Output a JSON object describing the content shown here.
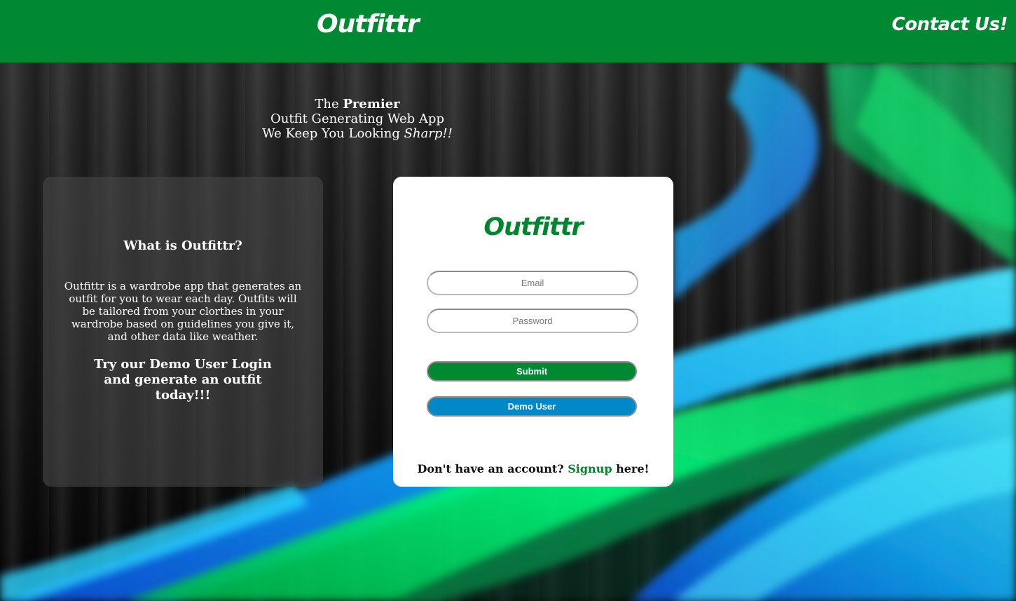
{
  "header": {
    "brand": "Outfittr",
    "contact": "Contact Us!"
  },
  "tagline": {
    "line1_prefix": "The ",
    "line1_bold": "Premier",
    "line2": "Outfit Generating Web App",
    "line3_prefix": "We Keep You Looking ",
    "line3_italic": "Sharp!!"
  },
  "info": {
    "title": "What is Outfittr?",
    "body": "Outfittr is a wardrobe app that generates an outfit for you to wear each day. Outfits will be tailored from your clorthes in your wardrobe based on guidelines you give it, and other data like weather.",
    "cta": "Try our Demo User Login and generate an outfit today!!!"
  },
  "login": {
    "logo": "Outfittr",
    "email_placeholder": "Email",
    "password_placeholder": "Password",
    "submit_label": "Submit",
    "demo_label": "Demo User",
    "signup_prefix": "Don't have an account? ",
    "signup_link": "Signup",
    "signup_suffix": " here!"
  },
  "colors": {
    "brand_green": "#008833",
    "demo_blue": "#0088c8",
    "card_bg": "#ffffff"
  }
}
